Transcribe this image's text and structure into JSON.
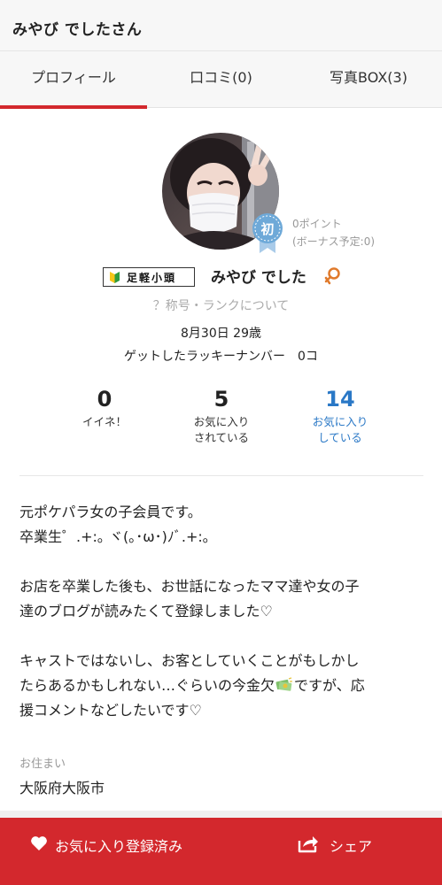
{
  "header": {
    "title": "みやび でしたさん"
  },
  "tabs": [
    {
      "label": "プロフィール",
      "active": true
    },
    {
      "label": "口コミ(0)",
      "active": false
    },
    {
      "label": "写真BOX(3)",
      "active": false
    }
  ],
  "profile": {
    "rank_badge_char": "初",
    "points": "0ポイント",
    "bonus": "(ボーナス予定:0)",
    "title_badge": "足軽小頭",
    "name": "みやび でした",
    "rank_link": "？称号・ランクについて",
    "birthday": "8月30日 29歳",
    "lucky_number": "ゲットしたラッキーナンバー　0コ"
  },
  "stats": [
    {
      "value": "0",
      "label_lines": [
        "イイネ！"
      ]
    },
    {
      "value": "5",
      "label_lines": [
        "お気に入り",
        "されている"
      ]
    },
    {
      "value": "14",
      "label_lines": [
        "お気に入り",
        "している"
      ]
    }
  ],
  "bio_lines": [
    "元ポケパラ女の子会員です。",
    "卒業生゜.+:｡ ヾ(｡･ω･)ﾉﾞ.+:｡",
    "",
    "お店を卒業した後も、お世話になったママ達や女の子",
    "達のブログが読みたくて登録しました♡",
    "",
    "キャストではないし、お客としていくことがもしかし",
    "たらあるかもしれない…ぐらいの今金欠",
    "援コメントなどしたいです♡"
  ],
  "bio_line7_suffix": "ですが、応",
  "residence": {
    "label": "お住まい",
    "value": "大阪府大阪市"
  },
  "bottom_bar": {
    "favorite_label": "お気に入り登録済み",
    "share_label": "シェア"
  },
  "colors": {
    "accent_red": "#d3282d",
    "link_blue": "#2a78c6",
    "muted_gray": "#999999",
    "rank_badge_blue": "#6ea9d8"
  },
  "icons": {
    "heart": "heart-icon",
    "share": "share-icon",
    "gender": "female-icon",
    "money": "money-icon",
    "beginner": "beginner-mark-icon"
  }
}
